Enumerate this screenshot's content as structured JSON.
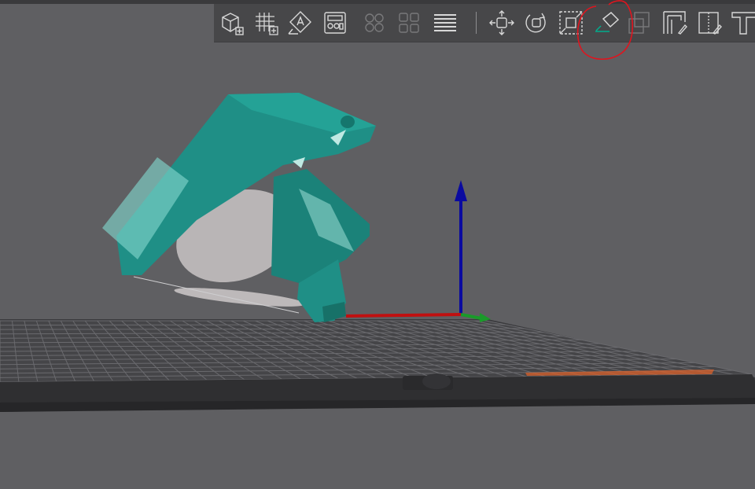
{
  "app": {
    "title": ""
  },
  "toolbar": {
    "tools": [
      {
        "id": "add",
        "name": "add-object-button",
        "icon": "cube-plus-icon",
        "enabled": true
      },
      {
        "id": "add-plate",
        "name": "add-plate-button",
        "icon": "grid-plus-icon",
        "enabled": true
      },
      {
        "id": "orient",
        "name": "auto-orient-button",
        "icon": "auto-orient-icon",
        "enabled": true
      },
      {
        "id": "arrange",
        "name": "arrange-button",
        "icon": "arrange-icon",
        "enabled": true
      },
      {
        "id": "split-objects",
        "name": "split-objects-button",
        "icon": "split-objects-icon",
        "enabled": false
      },
      {
        "id": "split-parts",
        "name": "split-parts-button",
        "icon": "split-parts-icon",
        "enabled": false
      },
      {
        "id": "layers",
        "name": "variable-layer-button",
        "icon": "layers-icon",
        "enabled": true
      },
      {
        "id": "move",
        "name": "move-button",
        "icon": "move-icon",
        "enabled": true
      },
      {
        "id": "rotate",
        "name": "rotate-button",
        "icon": "rotate-icon",
        "enabled": true
      },
      {
        "id": "scale",
        "name": "scale-button",
        "icon": "scale-icon",
        "enabled": true
      },
      {
        "id": "lay-on-face",
        "name": "lay-on-face-button",
        "icon": "lay-on-face-icon",
        "enabled": true,
        "highlighted": true
      },
      {
        "id": "cut",
        "name": "cut-button",
        "icon": "cut-icon",
        "enabled": false
      },
      {
        "id": "support-paint",
        "name": "support-paint-button",
        "icon": "support-paint-icon",
        "enabled": true
      },
      {
        "id": "seam-paint",
        "name": "seam-paint-button",
        "icon": "seam-paint-icon",
        "enabled": true
      },
      {
        "id": "text",
        "name": "text-button",
        "icon": "text-tool-icon",
        "enabled": true
      }
    ]
  },
  "colors": {
    "background": "#5f5f62",
    "toolbar": "#474749",
    "icon": "#d8d8d8",
    "accent": "#00ae8e",
    "model": "#1f8f86",
    "annotation": "#e0141e",
    "axis_x": "#c01010",
    "axis_y": "#1a9a2a",
    "axis_z": "#0a0aa0"
  }
}
